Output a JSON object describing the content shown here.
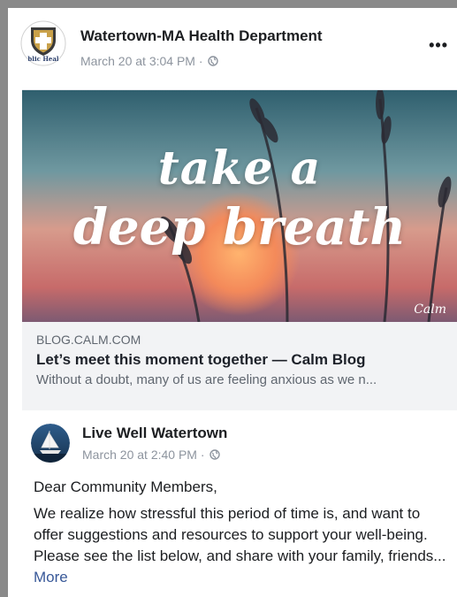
{
  "post": {
    "page_name": "Watertown-MA Health Department",
    "timestamp": "March 20 at 3:04 PM",
    "separator": " · ",
    "logo_text": "blic Heal",
    "more_icon": "ellipsis-icon",
    "privacy_icon": "globe-icon"
  },
  "link": {
    "hero_line_1": "take a",
    "hero_line_2": "deep breath",
    "hero_brand": "Calm",
    "domain": "BLOG.CALM.COM",
    "title": "Let’s meet this moment together — Calm Blog",
    "description": "Without a doubt, many of us are feeling anxious as we n..."
  },
  "shared_post": {
    "page_name": "Live Well Watertown",
    "timestamp": "March 20 at 2:40 PM",
    "separator": " · ",
    "greeting": "Dear Community Members,",
    "body": "We realize how stressful this period of time is, and want to offer suggestions and resources to support your well-being. Please see the list below, and share with your family, friends...",
    "more_label": "More"
  },
  "colors": {
    "link_blue": "#385898",
    "meta_gray": "#8d949e",
    "caption_bg": "#f2f3f5"
  }
}
